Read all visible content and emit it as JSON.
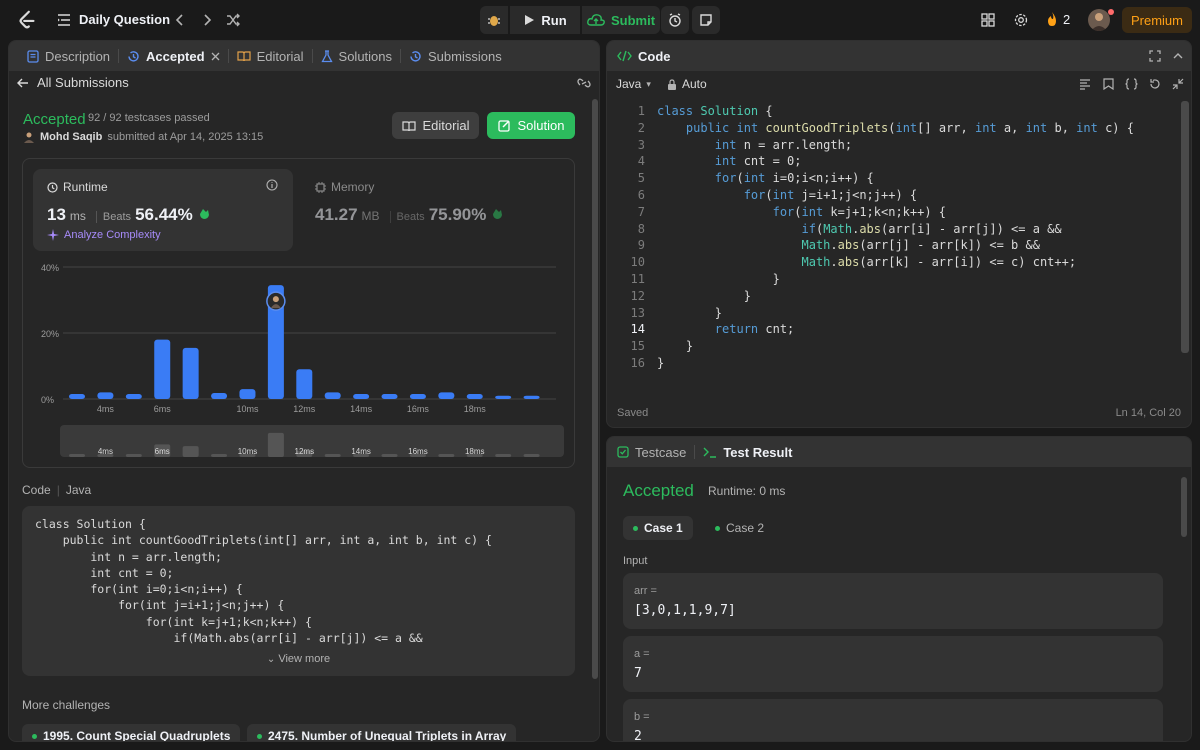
{
  "topbar": {
    "title": "Daily Question",
    "run_label": "Run",
    "submit_label": "Submit",
    "streak_count": "2",
    "premium_label": "Premium"
  },
  "left": {
    "tabs": [
      {
        "label": "Description"
      },
      {
        "label": "Accepted"
      },
      {
        "label": "Editorial"
      },
      {
        "label": "Solutions"
      },
      {
        "label": "Submissions"
      }
    ],
    "back_label": "All Submissions",
    "status": "Accepted",
    "testcases": "92 / 92 testcases passed",
    "user": "Mohd Saqib",
    "submitted": "submitted at Apr 14, 2025 13:15",
    "editorial_btn": "Editorial",
    "solution_btn": "Solution",
    "runtime": {
      "label": "Runtime",
      "value": "13",
      "unit": "ms",
      "beats_label": "Beats",
      "beats": "56.44%",
      "analyze": "Analyze Complexity"
    },
    "memory": {
      "label": "Memory",
      "value": "41.27",
      "unit": "MB",
      "beats_label": "Beats",
      "beats": "75.90%"
    },
    "code_header_lang": "Code",
    "code_header_java": "Java",
    "code_preview": "class Solution {\n    public int countGoodTriplets(int[] arr, int a, int b, int c) {\n        int n = arr.length;\n        int cnt = 0;\n        for(int i=0;i<n;i++) {\n            for(int j=i+1;j<n;j++) {\n                for(int k=j+1;k<n;k++) {\n                    if(Math.abs(arr[i] - arr[j]) <= a &&",
    "view_more": "View more",
    "more_challenges": "More challenges",
    "challenges": [
      "1995. Count Special Quadruplets",
      "2475. Number of Unequal Triplets in Array"
    ]
  },
  "chart_data": {
    "type": "bar",
    "categories": [
      "",
      "4ms",
      "",
      "6ms",
      "",
      "",
      "10ms",
      "",
      "12ms",
      "",
      "14ms",
      "",
      "16ms",
      "",
      "18ms",
      "",
      ""
    ],
    "values": [
      1.5,
      2,
      1.5,
      18,
      15.5,
      1.8,
      3,
      34.5,
      9,
      2,
      1.5,
      1.5,
      1.5,
      2,
      1.5,
      1,
      1
    ],
    "ylim": [
      0,
      40
    ],
    "yticks": [
      "0%",
      "20%",
      "40%"
    ],
    "highlight_index": 7,
    "grid": true,
    "bar_color": "#3a7cf5"
  },
  "editor": {
    "header": "Code",
    "language": "Java",
    "mode": "Auto",
    "code_lines": [
      "class Solution {",
      "    public int countGoodTriplets(int[] arr, int a, int b, int c) {",
      "        int n = arr.length;",
      "        int cnt = 0;",
      "        for(int i=0;i<n;i++) {",
      "            for(int j=i+1;j<n;j++) {",
      "                for(int k=j+1;k<n;k++) {",
      "                    if(Math.abs(arr[i] - arr[j]) <= a &&",
      "                    Math.abs(arr[j] - arr[k]) <= b &&",
      "                    Math.abs(arr[k] - arr[i]) <= c) cnt++;",
      "                }",
      "            }",
      "        }",
      "        return cnt;",
      "    }",
      "}"
    ],
    "saved": "Saved",
    "cursor": "Ln 14, Col 20"
  },
  "test": {
    "tab_testcase": "Testcase",
    "tab_result": "Test Result",
    "status": "Accepted",
    "runtime": "Runtime: 0 ms",
    "case1": "Case 1",
    "case2": "Case 2",
    "input_label": "Input",
    "vars": [
      {
        "name": "arr =",
        "value": "[3,0,1,1,9,7]"
      },
      {
        "name": "a =",
        "value": "7"
      },
      {
        "name": "b =",
        "value": "2"
      }
    ]
  }
}
